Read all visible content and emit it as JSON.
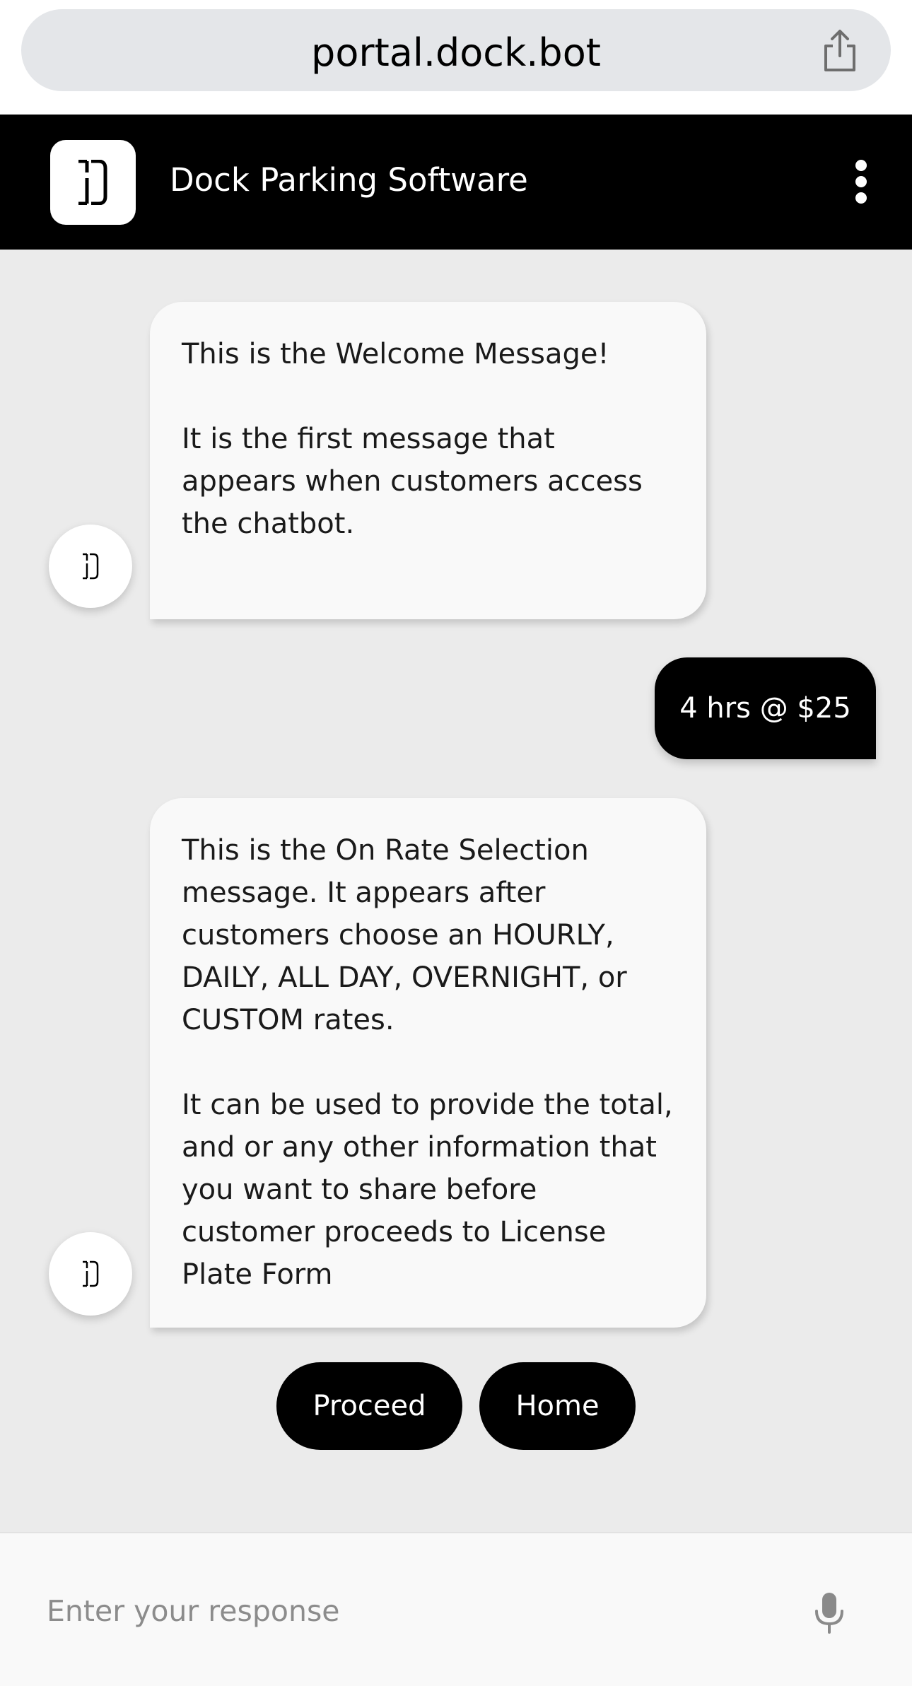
{
  "browser": {
    "url": "portal.dock.bot",
    "share_icon": "share-icon"
  },
  "header": {
    "logo_icon": "dock-logo-icon",
    "title": "Dock Parking Software",
    "menu_icon": "more-vertical-icon"
  },
  "chat": {
    "bot_avatar_icon": "dock-logo-icon",
    "messages": [
      {
        "sender": "bot",
        "text": "This is the Welcome Message!\n\nIt is the first message that appears when customers access the chatbot."
      },
      {
        "sender": "user",
        "text": "4 hrs @ $25"
      },
      {
        "sender": "bot",
        "text": "This is the On Rate Selection message. It appears after customers choose an HOURLY, DAILY, ALL DAY, OVERNIGHT, or CUSTOM rates.\n\nIt can be used to provide the total, and or any other information that you want to share before customer proceeds to License Plate Form"
      }
    ],
    "quick_replies": [
      {
        "label": "Proceed"
      },
      {
        "label": "Home"
      }
    ]
  },
  "composer": {
    "placeholder": "Enter your response",
    "mic_icon": "microphone-icon"
  },
  "colors": {
    "header_bg": "#000000",
    "chat_bg": "#ebebeb",
    "bot_bubble": "#f9f9f9",
    "user_bubble": "#000000",
    "url_pill": "#e4e6e9"
  }
}
